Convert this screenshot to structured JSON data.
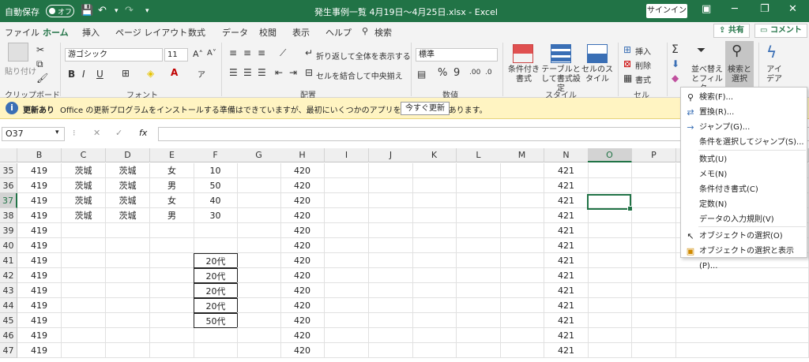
{
  "titlebar": {
    "autosave_label": "自動保存",
    "autosave_state": "オフ",
    "title": "発生事例一覧 4月19日～4月25日.xlsx  -  Excel",
    "signin": "サインイン",
    "minimize": "─",
    "restore": "❐",
    "close": "✕"
  },
  "tabs": [
    "ファイル",
    "ホーム",
    "挿入",
    "ページ レイアウト",
    "数式",
    "データ",
    "校閲",
    "表示",
    "ヘルプ",
    "検索"
  ],
  "tab_active": "ホーム",
  "share": "共有",
  "comment": "コメント",
  "ribbon": {
    "clipboard": {
      "paste": "貼り付け",
      "label": "クリップボード"
    },
    "font": {
      "name": "游ゴシック",
      "size": "11",
      "label": "フォント",
      "bold": "B",
      "italic": "I",
      "underline": "U"
    },
    "alignment": {
      "wrap": "折り返して全体を表示する",
      "merge": "セルを結合して中央揃え",
      "label": "配置"
    },
    "number": {
      "format": "標準",
      "label": "数値"
    },
    "styles": {
      "conditional": "条件付き書式",
      "table": "テーブルとして書式設定",
      "cell": "セルのスタイル",
      "label": "スタイル"
    },
    "cells": {
      "insert": "挿入",
      "delete": "削除",
      "format": "書式",
      "label": "セル"
    },
    "editing": {
      "sort": "並べ替えとフィルター",
      "find": "検索と選択"
    },
    "ideas": "アイデア"
  },
  "notification": {
    "title": "更新あり",
    "message": "Office の更新プログラムをインストールする準備はできていますが、最初にいくつかのアプリを閉じる必要があります。",
    "button": "今すぐ更新"
  },
  "formula_bar": {
    "name_box": "O37",
    "fx": "fx",
    "formula": ""
  },
  "columns": [
    "B",
    "C",
    "D",
    "E",
    "F",
    "G",
    "H",
    "I",
    "J",
    "K",
    "L",
    "M",
    "N",
    "O",
    "P"
  ],
  "selected_column": "O",
  "selected_row": "37",
  "rows": [
    {
      "n": "35",
      "B": "419",
      "C": "茨城",
      "D": "茨城",
      "E": "女",
      "F": "10",
      "H": "420",
      "N": "421"
    },
    {
      "n": "36",
      "B": "419",
      "C": "茨城",
      "D": "茨城",
      "E": "男",
      "F": "50",
      "H": "420",
      "N": "421"
    },
    {
      "n": "37",
      "B": "419",
      "C": "茨城",
      "D": "茨城",
      "E": "女",
      "F": "40",
      "H": "420",
      "N": "421"
    },
    {
      "n": "38",
      "B": "419",
      "C": "茨城",
      "D": "茨城",
      "E": "男",
      "F": "30",
      "H": "420",
      "N": "421"
    },
    {
      "n": "39",
      "B": "419",
      "H": "420",
      "N": "421"
    },
    {
      "n": "40",
      "B": "419",
      "H": "420",
      "N": "421"
    },
    {
      "n": "41",
      "B": "419",
      "F": "20代",
      "H": "420",
      "N": "421"
    },
    {
      "n": "42",
      "B": "419",
      "F": "20代",
      "H": "420",
      "N": "421"
    },
    {
      "n": "43",
      "B": "419",
      "F": "20代",
      "H": "420",
      "N": "421"
    },
    {
      "n": "44",
      "B": "419",
      "F": "20代",
      "H": "420",
      "N": "421"
    },
    {
      "n": "45",
      "B": "419",
      "F": "50代",
      "H": "420",
      "N": "421"
    },
    {
      "n": "46",
      "B": "419",
      "H": "420",
      "N": "421"
    },
    {
      "n": "47",
      "B": "419",
      "H": "420",
      "N": "421"
    }
  ],
  "boxed_rows_F": [
    "41",
    "42",
    "43",
    "44",
    "45"
  ],
  "find_menu": [
    {
      "label": "検索(F)...",
      "icon": "search-icon"
    },
    {
      "label": "置換(R)...",
      "icon": "replace-icon"
    },
    {
      "label": "ジャンプ(G)...",
      "icon": "arrow-right-icon"
    },
    {
      "label": "条件を選択してジャンプ(S)...",
      "icon": ""
    },
    {
      "label": "数式(U)",
      "icon": ""
    },
    {
      "label": "メモ(N)",
      "icon": ""
    },
    {
      "label": "条件付き書式(C)",
      "icon": ""
    },
    {
      "label": "定数(N)",
      "icon": ""
    },
    {
      "label": "データの入力規則(V)",
      "icon": ""
    },
    {
      "label": "オブジェクトの選択(O)",
      "icon": "pointer-icon"
    },
    {
      "label": "オブジェクトの選択と表示(P)...",
      "icon": "selection-pane-icon"
    }
  ],
  "colors": {
    "excel_green": "#217346",
    "notif_bg": "#fff4c2"
  }
}
